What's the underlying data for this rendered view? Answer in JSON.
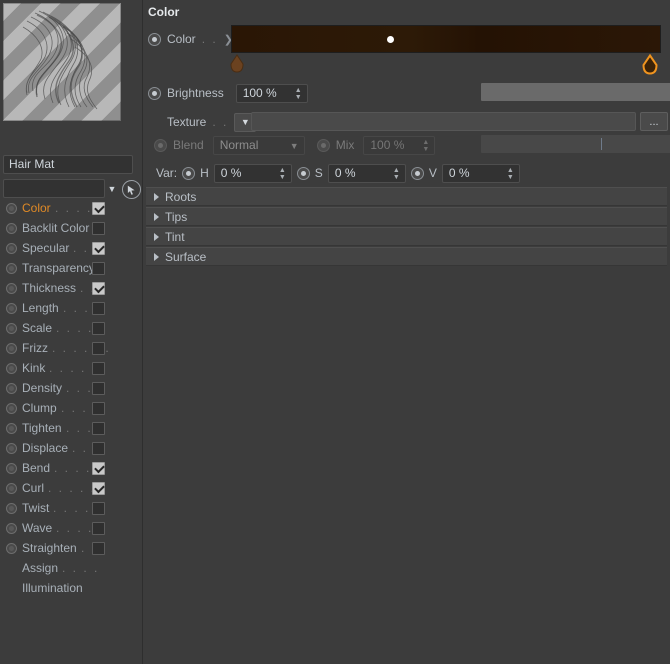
{
  "preview": {
    "name": "material-preview-thumbnail"
  },
  "material": {
    "name_value": "Hair Mat",
    "name_placeholder": "",
    "combo_value": "",
    "picker_icon": "arrow-cursor-icon",
    "dropdown_icon": "chevron-down-icon"
  },
  "channels": [
    {
      "label": "Color",
      "dots": ". . . . .",
      "checked": true,
      "active": true,
      "radio": true
    },
    {
      "label": "Backlit Color",
      "dots": "",
      "checked": false,
      "active": false,
      "radio": true
    },
    {
      "label": "Specular",
      "dots": ". . .",
      "checked": true,
      "active": false,
      "radio": true
    },
    {
      "label": "Transparency",
      "dots": "",
      "checked": false,
      "active": false,
      "radio": true
    },
    {
      "label": "Thickness",
      "dots": ". .",
      "checked": true,
      "active": false,
      "radio": true
    },
    {
      "label": "Length",
      "dots": ". . . .",
      "checked": false,
      "active": false,
      "radio": true
    },
    {
      "label": "Scale",
      "dots": ". . . . .",
      "checked": false,
      "active": false,
      "radio": true
    },
    {
      "label": "Frizz",
      "dots": ". . . . . .",
      "checked": false,
      "active": false,
      "radio": true
    },
    {
      "label": "Kink",
      "dots": ". . . . . .",
      "checked": false,
      "active": false,
      "radio": true
    },
    {
      "label": "Density",
      "dots": ". . . .",
      "checked": false,
      "active": false,
      "radio": true
    },
    {
      "label": "Clump",
      "dots": ". . . .",
      "checked": false,
      "active": false,
      "radio": true
    },
    {
      "label": "Tighten",
      "dots": ". . . .",
      "checked": false,
      "active": false,
      "radio": true
    },
    {
      "label": "Displace",
      "dots": ". . .",
      "checked": false,
      "active": false,
      "radio": true
    },
    {
      "label": "Bend",
      "dots": ". . . . .",
      "checked": true,
      "active": false,
      "radio": true
    },
    {
      "label": "Curl",
      "dots": ". . . . . .",
      "checked": true,
      "active": false,
      "radio": true
    },
    {
      "label": "Twist",
      "dots": ". . . . .",
      "checked": false,
      "active": false,
      "radio": true
    },
    {
      "label": "Wave",
      "dots": ". . . . .",
      "checked": false,
      "active": false,
      "radio": true
    },
    {
      "label": "Straighten",
      "dots": ". .",
      "checked": false,
      "active": false,
      "radio": true
    },
    {
      "label": "Assign",
      "dots": ". . . .",
      "checked": null,
      "active": false,
      "radio": false
    },
    {
      "label": "Illumination",
      "dots": "",
      "checked": null,
      "active": false,
      "radio": false
    }
  ],
  "panel": {
    "title": "Color",
    "color": {
      "label": "Color",
      "dots": ". .",
      "expand_icon": "chevron-right-icon",
      "gradient_stops": [
        "#2a1605",
        "#2d1a07",
        "#241204",
        "#2b1706"
      ],
      "marker_color": "#ffffff",
      "knot_left_color": "#6b4220",
      "knot_right_color": "#e08a26"
    },
    "brightness": {
      "label": "Brightness",
      "value": "100 %",
      "slider_fill_percent": 100,
      "handle_color": "#7b9fcb"
    },
    "texture": {
      "label": "Texture",
      "dots": ". .",
      "dropdown_icon": "chevron-down-icon",
      "field_value": "",
      "browse_label": "...",
      "browse_icon": "ellipsis-icon"
    },
    "blend": {
      "label": "Blend",
      "mode": "Normal",
      "dropdown_icon": "chevron-down-icon",
      "mix_label": "Mix",
      "mix_value": "100 %",
      "mix_slider_percent": 100
    },
    "variation": {
      "label": "Var:",
      "h_label": "H",
      "h_value": "0 %",
      "s_label": "S",
      "s_value": "0 %",
      "v_label": "V",
      "v_value": "0 %"
    },
    "sections": [
      {
        "label": "Roots",
        "expanded": false,
        "icon": "triangle-right-icon"
      },
      {
        "label": "Tips",
        "expanded": false,
        "icon": "triangle-right-icon"
      },
      {
        "label": "Tint",
        "expanded": false,
        "icon": "triangle-right-icon"
      },
      {
        "label": "Surface",
        "expanded": false,
        "icon": "triangle-right-icon"
      }
    ]
  },
  "colors": {
    "background": "#3c3c3c",
    "accent_orange": "#e08a26",
    "accent_blue": "#7b9fcb",
    "text": "#b9bfc6"
  }
}
